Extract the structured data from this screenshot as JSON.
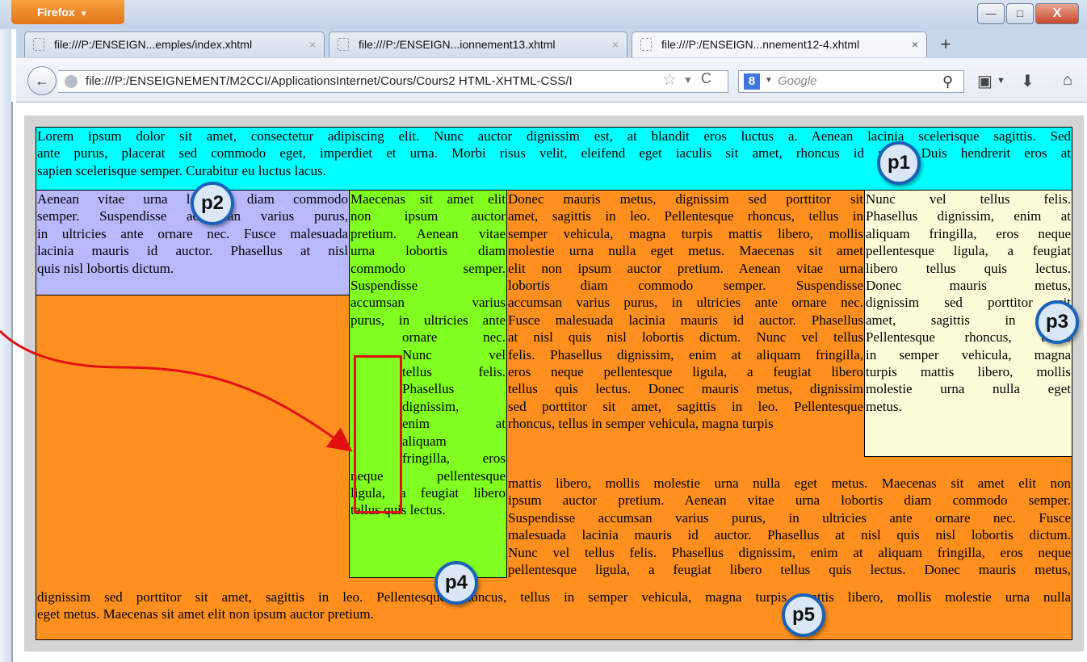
{
  "browser": {
    "app_button": "Firefox",
    "window_buttons": {
      "minimize": "—",
      "maximize": "□",
      "close": "X"
    },
    "tabs": [
      {
        "label": "file:///P:/ENSEIGN...emples/index.xhtml",
        "close": "×"
      },
      {
        "label": "file:///P:/ENSEIGN...ionnement13.xhtml",
        "close": "×"
      },
      {
        "label": "file:///P:/ENSEIGN...nnement12-4.xhtml",
        "close": "×"
      }
    ],
    "new_tab": "+",
    "back": "←",
    "url": "file:///P:/ENSEIGNEMENT/M2CCI/ApplicationsInternet/Cours/Cours2 HTML-XHTML-CSS/I",
    "url_star": "☆",
    "url_dropdown": "▼",
    "url_reload": "C",
    "search_engine": "8",
    "search_dropdown": "▼",
    "search_placeholder": "Google",
    "search_go": "⚲",
    "bookmarks_icon": "▣",
    "bookmarks_dropdown": "▼",
    "download_icon": "⬇",
    "home_icon": "⌂"
  },
  "page": {
    "p1_lines": [
      "Lorem ipsum dolor sit amet, consectetur adipiscing elit. Nunc auctor dignissim est, at blandit eros luctus a. Aenean lacinia scelerisque sagittis. Sed",
      "ante purus, placerat sed commodo eget, imperdiet et urna. Morbi risus velit, eleifend eget iaculis sit amet, rhoncus id risus. Duis hendrerit eros at",
      "sapien scelerisque semper. Curabitur eu luctus lacus."
    ],
    "p2_lines": [
      "Aenean vitae urna lobortis diam commodo",
      "semper. Suspendisse accumsan varius purus,",
      "in ultricies ante ornare nec. Fusce malesuada",
      "lacinia mauris id auctor. Phasellus at nisl",
      "quis nisl lobortis dictum."
    ],
    "p4_lines": [
      "Maecenas sit amet elit",
      "non ipsum auctor",
      "pretium. Aenean vitae",
      "urna lobortis diam",
      "commodo semper.",
      "Suspendisse",
      "accumsan varius",
      "purus, in ultricies ante",
      "ornare nec.",
      "Nunc vel",
      "tellus felis.",
      "Phasellus",
      "dignissim,",
      "enim at",
      "aliquam",
      "fringilla, eros",
      "neque pellentesque",
      "ligula, a feugiat libero",
      "tellus quis lectus."
    ],
    "p5_col_lines": [
      "Donec mauris metus, dignissim sed porttitor sit",
      "amet, sagittis in leo. Pellentesque rhoncus, tellus in",
      "semper vehicula, magna turpis mattis libero, mollis",
      "molestie urna nulla eget metus. Maecenas sit amet",
      "elit non ipsum auctor pretium. Aenean vitae urna",
      "lobortis diam commodo semper. Suspendisse",
      "accumsan varius purus, in ultricies ante ornare nec.",
      "Fusce malesuada lacinia mauris id auctor. Phasellus",
      "at nisl quis nisl lobortis dictum. Nunc vel tellus",
      "felis. Phasellus dignissim, enim at aliquam fringilla,",
      "eros neque pellentesque ligula, a feugiat libero",
      "tellus quis lectus. Donec mauris metus, dignissim",
      "sed porttitor sit amet, sagittis in leo. Pellentesque",
      "rhoncus, tellus in semper vehicula, magna turpis"
    ],
    "p5_wide_lines": [
      "mattis libero, mollis molestie urna nulla eget metus. Maecenas sit amet elit non",
      "ipsum auctor pretium. Aenean vitae urna lobortis diam commodo semper.",
      "Suspendisse accumsan varius purus, in ultricies ante ornare nec. Fusce",
      "malesuada lacinia mauris id auctor. Phasellus at nisl quis nisl lobortis dictum.",
      "Nunc vel tellus felis. Phasellus dignissim, enim at aliquam fringilla, eros neque",
      "pellentesque ligula, a feugiat libero tellus quis lectus. Donec mauris metus,"
    ],
    "p5_bottom_lines": [
      "dignissim sed porttitor sit amet, sagittis in leo. Pellentesque rhoncus, tellus in semper vehicula, magna turpis mattis libero, mollis molestie urna nulla",
      "eget metus. Maecenas sit amet elit non ipsum auctor pretium."
    ],
    "p3_lines": [
      "Nunc vel tellus felis.",
      "Phasellus dignissim, enim at",
      "aliquam fringilla, eros neque",
      "pellentesque ligula, a feugiat",
      "libero tellus quis lectus.",
      "Donec mauris metus,",
      "dignissim sed porttitor sit",
      "amet, sagittis in leo.",
      "Pellentesque rhoncus, tellus",
      "in semper vehicula, magna",
      "turpis mattis libero, mollis",
      "molestie urna nulla eget",
      "metus."
    ]
  },
  "markers": [
    "p1",
    "p2",
    "p3",
    "p4",
    "p5"
  ],
  "colors": {
    "p1": "#00ffff",
    "p2": "#b8b8ff",
    "p3": "#fcfbd8",
    "p4": "#80ff20",
    "p5": "#ff9020",
    "highlight": "#e01010",
    "marker_border": "#1a62b8"
  }
}
